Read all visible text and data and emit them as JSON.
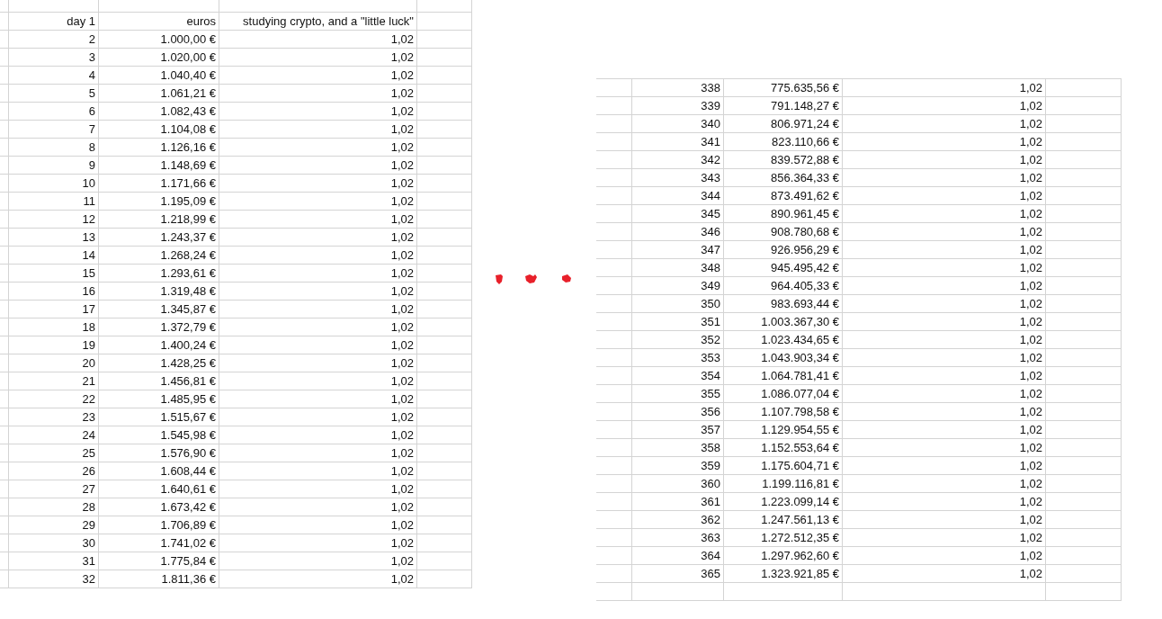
{
  "left_table": {
    "header": [
      "day 1",
      "euros",
      "studying crypto, and a \"little luck\""
    ],
    "rows": [
      {
        "day": "2",
        "euros": "1.000,00 €",
        "rate": "1,02"
      },
      {
        "day": "3",
        "euros": "1.020,00 €",
        "rate": "1,02"
      },
      {
        "day": "4",
        "euros": "1.040,40 €",
        "rate": "1,02"
      },
      {
        "day": "5",
        "euros": "1.061,21 €",
        "rate": "1,02"
      },
      {
        "day": "6",
        "euros": "1.082,43 €",
        "rate": "1,02"
      },
      {
        "day": "7",
        "euros": "1.104,08 €",
        "rate": "1,02"
      },
      {
        "day": "8",
        "euros": "1.126,16 €",
        "rate": "1,02"
      },
      {
        "day": "9",
        "euros": "1.148,69 €",
        "rate": "1,02"
      },
      {
        "day": "10",
        "euros": "1.171,66 €",
        "rate": "1,02"
      },
      {
        "day": "11",
        "euros": "1.195,09 €",
        "rate": "1,02"
      },
      {
        "day": "12",
        "euros": "1.218,99 €",
        "rate": "1,02"
      },
      {
        "day": "13",
        "euros": "1.243,37 €",
        "rate": "1,02"
      },
      {
        "day": "14",
        "euros": "1.268,24 €",
        "rate": "1,02"
      },
      {
        "day": "15",
        "euros": "1.293,61 €",
        "rate": "1,02"
      },
      {
        "day": "16",
        "euros": "1.319,48 €",
        "rate": "1,02"
      },
      {
        "day": "17",
        "euros": "1.345,87 €",
        "rate": "1,02"
      },
      {
        "day": "18",
        "euros": "1.372,79 €",
        "rate": "1,02"
      },
      {
        "day": "19",
        "euros": "1.400,24 €",
        "rate": "1,02"
      },
      {
        "day": "20",
        "euros": "1.428,25 €",
        "rate": "1,02"
      },
      {
        "day": "21",
        "euros": "1.456,81 €",
        "rate": "1,02"
      },
      {
        "day": "22",
        "euros": "1.485,95 €",
        "rate": "1,02"
      },
      {
        "day": "23",
        "euros": "1.515,67 €",
        "rate": "1,02"
      },
      {
        "day": "24",
        "euros": "1.545,98 €",
        "rate": "1,02"
      },
      {
        "day": "25",
        "euros": "1.576,90 €",
        "rate": "1,02"
      },
      {
        "day": "26",
        "euros": "1.608,44 €",
        "rate": "1,02"
      },
      {
        "day": "27",
        "euros": "1.640,61 €",
        "rate": "1,02"
      },
      {
        "day": "28",
        "euros": "1.673,42 €",
        "rate": "1,02"
      },
      {
        "day": "29",
        "euros": "1.706,89 €",
        "rate": "1,02"
      },
      {
        "day": "30",
        "euros": "1.741,02 €",
        "rate": "1,02"
      },
      {
        "day": "31",
        "euros": "1.775,84 €",
        "rate": "1,02"
      },
      {
        "day": "32",
        "euros": "1.811,36 €",
        "rate": "1,02"
      }
    ]
  },
  "right_table": {
    "rows": [
      {
        "day": "338",
        "euros": "775.635,56 €",
        "rate": "1,02"
      },
      {
        "day": "339",
        "euros": "791.148,27 €",
        "rate": "1,02"
      },
      {
        "day": "340",
        "euros": "806.971,24 €",
        "rate": "1,02"
      },
      {
        "day": "341",
        "euros": "823.110,66 €",
        "rate": "1,02"
      },
      {
        "day": "342",
        "euros": "839.572,88 €",
        "rate": "1,02"
      },
      {
        "day": "343",
        "euros": "856.364,33 €",
        "rate": "1,02"
      },
      {
        "day": "344",
        "euros": "873.491,62 €",
        "rate": "1,02"
      },
      {
        "day": "345",
        "euros": "890.961,45 €",
        "rate": "1,02"
      },
      {
        "day": "346",
        "euros": "908.780,68 €",
        "rate": "1,02"
      },
      {
        "day": "347",
        "euros": "926.956,29 €",
        "rate": "1,02"
      },
      {
        "day": "348",
        "euros": "945.495,42 €",
        "rate": "1,02"
      },
      {
        "day": "349",
        "euros": "964.405,33 €",
        "rate": "1,02"
      },
      {
        "day": "350",
        "euros": "983.693,44 €",
        "rate": "1,02"
      },
      {
        "day": "351",
        "euros": "1.003.367,30 €",
        "rate": "1,02"
      },
      {
        "day": "352",
        "euros": "1.023.434,65 €",
        "rate": "1,02"
      },
      {
        "day": "353",
        "euros": "1.043.903,34 €",
        "rate": "1,02"
      },
      {
        "day": "354",
        "euros": "1.064.781,41 €",
        "rate": "1,02"
      },
      {
        "day": "355",
        "euros": "1.086.077,04 €",
        "rate": "1,02"
      },
      {
        "day": "356",
        "euros": "1.107.798,58 €",
        "rate": "1,02"
      },
      {
        "day": "357",
        "euros": "1.129.954,55 €",
        "rate": "1,02"
      },
      {
        "day": "358",
        "euros": "1.152.553,64 €",
        "rate": "1,02"
      },
      {
        "day": "359",
        "euros": "1.175.604,71 €",
        "rate": "1,02"
      },
      {
        "day": "360",
        "euros": "1.199.116,81 €",
        "rate": "1,02"
      },
      {
        "day": "361",
        "euros": "1.223.099,14 €",
        "rate": "1,02"
      },
      {
        "day": "362",
        "euros": "1.247.561,13 €",
        "rate": "1,02"
      },
      {
        "day": "363",
        "euros": "1.272.512,35 €",
        "rate": "1,02"
      },
      {
        "day": "364",
        "euros": "1.297.962,60 €",
        "rate": "1,02"
      },
      {
        "day": "365",
        "euros": "1.323.921,85 €",
        "rate": "1,02"
      }
    ]
  }
}
